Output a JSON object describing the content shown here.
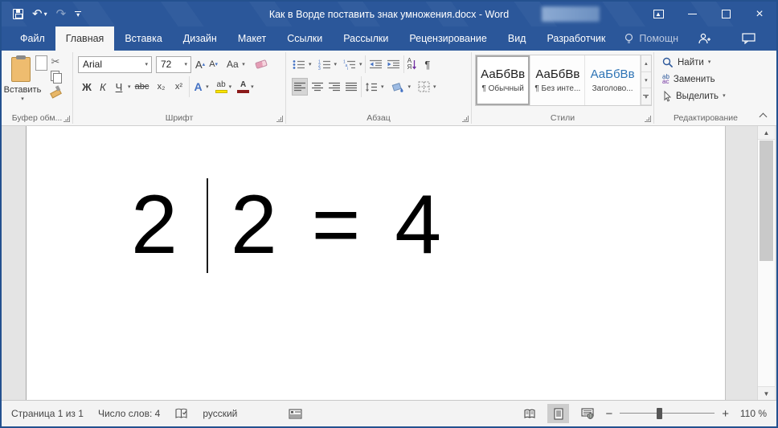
{
  "titlebar": {
    "title": "Как в Ворде поставить знак умножения.docx - Word"
  },
  "tabs": {
    "items": [
      {
        "label": "Файл",
        "active": false
      },
      {
        "label": "Главная",
        "active": true
      },
      {
        "label": "Вставка",
        "active": false
      },
      {
        "label": "Дизайн",
        "active": false
      },
      {
        "label": "Макет",
        "active": false
      },
      {
        "label": "Ссылки",
        "active": false
      },
      {
        "label": "Рассылки",
        "active": false
      },
      {
        "label": "Рецензирование",
        "active": false
      },
      {
        "label": "Вид",
        "active": false
      },
      {
        "label": "Разработчик",
        "active": false
      }
    ],
    "assistant_label": "Помощн"
  },
  "ribbon": {
    "clipboard": {
      "paste_label": "Вставить",
      "group_label": "Буфер обм..."
    },
    "font": {
      "font_name": "Arial",
      "font_size": "72",
      "grow_letter": "А",
      "shrink_letter": "А",
      "change_case": "Aa",
      "bold": "Ж",
      "italic": "К",
      "underline": "Ч",
      "strikethrough": "abc",
      "subscript": "x₂",
      "superscript": "x²",
      "effects_letter": "А",
      "highlight_letters": "ab",
      "color_letter": "А",
      "group_label": "Шрифт"
    },
    "paragraph": {
      "sort_top": "А",
      "sort_bottom": "Я",
      "pilcrow": "¶",
      "group_label": "Абзац"
    },
    "styles": {
      "group_label": "Стили",
      "items": [
        {
          "sample": "АаБбВв",
          "name": "¶ Обычный",
          "selected": true
        },
        {
          "sample": "АаБбВв",
          "name": "¶ Без инте...",
          "selected": false
        },
        {
          "sample": "АаБбВв",
          "name": "Заголово...",
          "selected": false
        }
      ]
    },
    "editing": {
      "find_label": "Найти",
      "replace_top": "ab",
      "replace_bottom": "ac",
      "replace_label": "Заменить",
      "select_label": "Выделить",
      "group_label": "Редактирование"
    }
  },
  "document": {
    "text": "2 2 = 4",
    "before_cursor": "2",
    "after_cursor": "2 = 4"
  },
  "statusbar": {
    "page": "Страница 1 из 1",
    "words": "Число слов: 4",
    "language": "русский",
    "zoom": "110 %"
  },
  "icons": {
    "dropdown": "▾",
    "dropup": "▴",
    "scissors": "✂",
    "scroll_up": "▲",
    "scroll_down": "▼",
    "minus": "−",
    "plus": "+",
    "close": "×",
    "ribbon_display_arrow": "▲"
  },
  "colors": {
    "titlebar_blue": "#2b579a",
    "accent_blue": "#4472c4",
    "heading_blue": "#2e74b5",
    "highlight_yellow": "#ffe600",
    "font_color_red": "#8b1a1a",
    "doc_bg": "#e4e4e4"
  }
}
